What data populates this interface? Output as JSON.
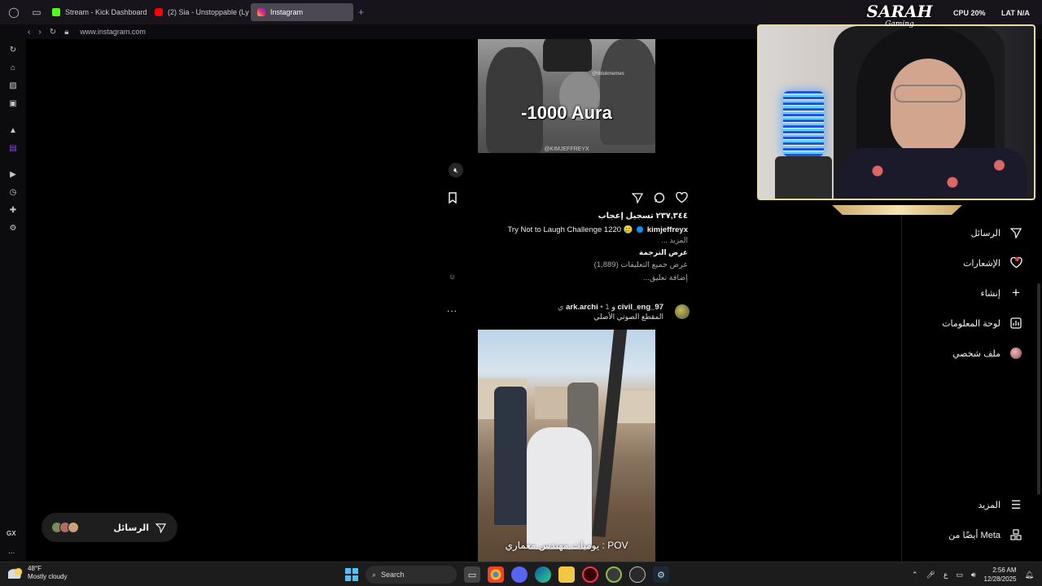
{
  "browser": {
    "tabs": [
      {
        "label": "Stream - Kick Dashboard",
        "favicon": "kick-icon"
      },
      {
        "label": "(2) Sia - Unstoppable (Ly",
        "favicon": "youtube-icon"
      },
      {
        "label": "Instagram",
        "favicon": "instagram-icon",
        "active": true
      }
    ],
    "new_tab_label": "+",
    "url": "www.instagram.com"
  },
  "overlay": {
    "brand": "SARAH",
    "brand_sub": "Gaming",
    "cpu_label": "CPU",
    "cpu_value": "20%",
    "lat_label": "LAT",
    "lat_value": "N/A"
  },
  "post1": {
    "image_text": "-1000 Aura",
    "watermark_top": "@tiktokmemes",
    "watermark_bottom": "@KIMJEFFREYX",
    "mute_icon": "mute-icon",
    "likes": "٢٣٧,٣٤٤ تسجيل إعجاب",
    "caption_user": "kimjeffreyx",
    "caption_text": "Try Not to Laugh Challenge 1220 🥲",
    "more": "المزيد ...",
    "translate": "عرض الترجمة",
    "view_comments": "عرض جميع التعليقات (1,889)",
    "add_comment": "إضافة تعليق..."
  },
  "post2": {
    "user1": "civil_eng_97",
    "joiner": "و",
    "user2": "ark.archi",
    "time": "• 1 ي",
    "audio": "المقطع الصوتي الأصلي",
    "more_label": "...",
    "overlay_text": "يوميات مهندس معماري : POV"
  },
  "right_nav": [
    {
      "label": "الرسائل",
      "icon": "send-icon"
    },
    {
      "label": "الإشعارات",
      "icon": "heart-icon",
      "badge": true
    },
    {
      "label": "إنشاء",
      "icon": "plus-icon"
    },
    {
      "label": "لوحة المعلومات",
      "icon": "dashboard-icon"
    },
    {
      "label": "ملف شخصي",
      "icon": "avatar-icon"
    },
    {
      "label": "المزيد",
      "icon": "menu-icon"
    },
    {
      "label": "أيضًا من Meta",
      "icon": "meta-icon"
    }
  ],
  "messages_pill": {
    "label": "الرسائل"
  },
  "taskbar": {
    "temp": "48°F",
    "weather": "Mostly cloudy",
    "search_label": "Search",
    "keyboard_lang": "ع",
    "time": "2:56 AM",
    "date": "12/28/2025"
  },
  "sidebar": {
    "gx_label": "GX",
    "more_label": "..."
  }
}
